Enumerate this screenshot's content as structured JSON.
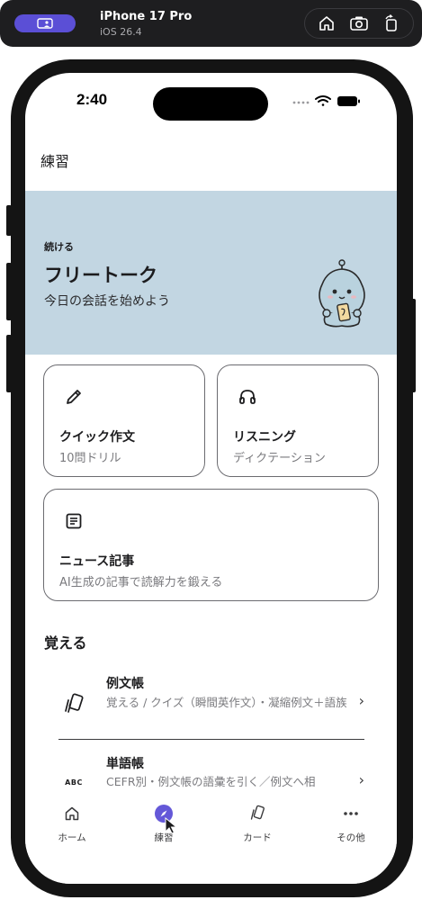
{
  "simulator": {
    "device_name": "iPhone 17 Pro",
    "os_version": "iOS 26.4",
    "buttons": [
      "home-icon",
      "screenshot-icon",
      "rotate-icon"
    ]
  },
  "status_bar": {
    "time": "2:40"
  },
  "nav": {
    "title": "練習"
  },
  "hero": {
    "kicker": "続ける",
    "title": "フリートーク",
    "subtitle": "今日の会話を始めよう",
    "background": "#c2d6e2"
  },
  "cards": [
    {
      "icon": "pencil-icon",
      "title": "クイック作文",
      "subtitle": "10問ドリル"
    },
    {
      "icon": "headphones-icon",
      "title": "リスニング",
      "subtitle": "ディクテーション"
    },
    {
      "icon": "article-icon",
      "title": "ニュース記事",
      "subtitle": "AI生成の記事で読解力を鍛える"
    }
  ],
  "learn_section": {
    "title": "覚える",
    "items": [
      {
        "icon": "cards-icon",
        "title": "例文帳",
        "subtitle": "覚える / クイズ（瞬間英作文）・凝縮例文＋語族"
      },
      {
        "icon": "abc-icon",
        "icon_text": "ABC",
        "title": "単語帳",
        "subtitle": "CEFR別・例文帳の語彙を引く／例文へ相"
      }
    ]
  },
  "tabbar": {
    "accent": "#6458d8",
    "tabs": [
      {
        "label": "ホーム",
        "icon": "home-icon",
        "active": false
      },
      {
        "label": "練習",
        "icon": "compass-icon",
        "active": true
      },
      {
        "label": "カード",
        "icon": "cards-icon",
        "active": false
      },
      {
        "label": "その他",
        "icon": "more-icon",
        "active": false
      }
    ]
  }
}
